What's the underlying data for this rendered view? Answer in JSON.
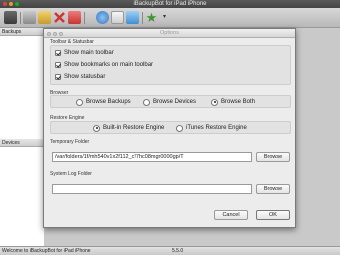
{
  "window": {
    "title": "iBackupBot for iPad iPhone"
  },
  "left_pane": {
    "backups_header": "Backups",
    "devices_header": "Devices"
  },
  "statusbar": {
    "message": "Welcome to iBackupBot for iPad iPhone",
    "version": "5.5.0"
  },
  "dialog": {
    "title": "Options",
    "toolbar_group": {
      "label": "Toolbar & Statusbar",
      "options": [
        {
          "label": "Show main toolbar",
          "checked": true
        },
        {
          "label": "Show bookmarks on main toolbar",
          "checked": true
        },
        {
          "label": "Show statusbar",
          "checked": true
        }
      ]
    },
    "browser_group": {
      "label": "Browser",
      "options": [
        {
          "label": "Browse Backups",
          "selected": false
        },
        {
          "label": "Browse Devices",
          "selected": false
        },
        {
          "label": "Browse Both",
          "selected": true
        }
      ]
    },
    "restore_group": {
      "label": "Restore Engine",
      "options": [
        {
          "label": "Built-in Restore Engine",
          "selected": true
        },
        {
          "label": "iTunes Restore Engine",
          "selected": false
        }
      ]
    },
    "temp_folder": {
      "label": "Temporary Folder",
      "value": "/var/folders/1f/mh540v1x2f112_c!7hc08mgr0000gp/T",
      "browse_label": "Browse"
    },
    "log_folder": {
      "label": "System Log Folder",
      "value": "",
      "browse_label": "Browse"
    },
    "cancel_label": "Cancel",
    "ok_label": "OK"
  },
  "icons": [
    "close-icon",
    "minimize-icon",
    "zoom-icon",
    "backup-icon",
    "edit-icon",
    "delete-icon",
    "restore-icon",
    "home-icon",
    "refresh-icon",
    "bookmark-star-icon",
    "dropdown-icon"
  ],
  "colors": {
    "title_bar": "#4a4a4a",
    "dialog_bg": "#ececec",
    "group_bg": "#e2e2e2"
  }
}
